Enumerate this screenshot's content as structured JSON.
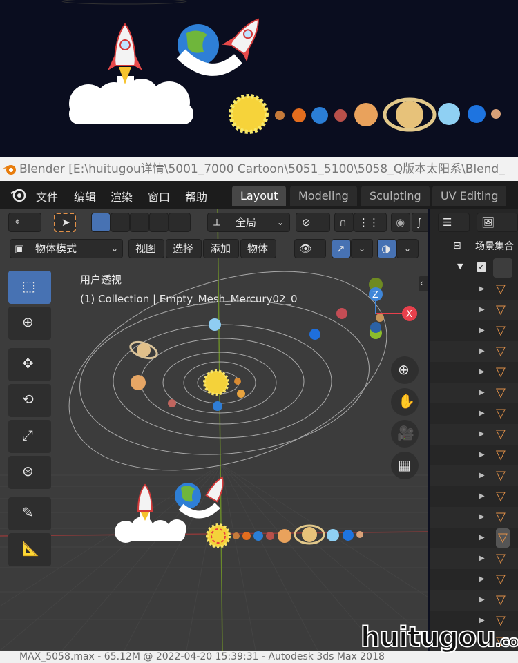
{
  "title_bar": {
    "text": "Blender [E:\\huitugou详情\\5001_7000 Cartoon\\5051_5100\\5058_Q版本太阳系\\Blend_"
  },
  "menu": {
    "items": [
      "文件",
      "编辑",
      "渲染",
      "窗口",
      "帮助"
    ]
  },
  "workspaces": {
    "tabs": [
      "Layout",
      "Modeling",
      "Sculpting",
      "UV Editing"
    ],
    "active": "Layout"
  },
  "header": {
    "transform_orientation": "全局",
    "mode": "物体模式",
    "view_menus": [
      "视图",
      "选择",
      "添加",
      "物体"
    ]
  },
  "viewport": {
    "view_name": "用户透视",
    "object_info": "(1) Collection | Empty_Mesh_Mercury02_0",
    "gizmo_axes": [
      "Z",
      "X"
    ]
  },
  "outliner": {
    "scene_collection": "场景集合"
  },
  "status_bar": {
    "text": "MAX_5058.max - 65.12M @ 2022-04-20 15:39:31 - Autodesk 3ds Max 2018"
  },
  "watermark": {
    "brand": "huitugou",
    "suffix": ".com"
  },
  "colors": {
    "accent": "#4772b3",
    "x_axis": "#e8404c",
    "y_axis": "#8bbd2a",
    "z_axis": "#3f86d8",
    "outliner_icon": "#e39148"
  }
}
